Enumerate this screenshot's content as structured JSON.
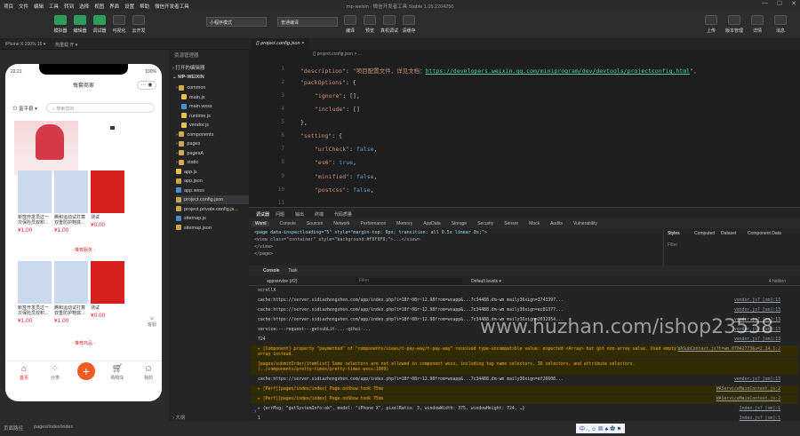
{
  "menubar": {
    "items": [
      "项目",
      "文件",
      "编辑",
      "工具",
      "转到",
      "选择",
      "视图",
      "界面",
      "设置",
      "帮助",
      "微信开发者工具"
    ],
    "title": "mp-weixin - 微信开发者工具 Stable 1.05.2204250"
  },
  "toolbar": {
    "left_buttons": [
      "模拟器",
      "编辑器",
      "调试器",
      "可视化",
      "云开发"
    ],
    "mode_select": "小程序模式",
    "compile_select": "普通编译",
    "right_buttons": [
      "编译",
      "预览",
      "真机调试",
      "清缓存"
    ],
    "far_right_buttons": [
      "上传",
      "版本管理",
      "详情",
      "消息"
    ]
  },
  "subbar": {
    "device": "iPhone X 100% 16 ▾",
    "hotreload": "热重载 开 ▾"
  },
  "editor_tab": {
    "label": "project.config.json"
  },
  "breadcrumb": "{} project.config.json > ...",
  "filetree": {
    "header": "资源管理器",
    "open_editors": "打开的编辑器",
    "root": "MP-WEIXIN",
    "items": [
      {
        "label": "common",
        "type": "folder",
        "indent": 1
      },
      {
        "label": "main.js",
        "type": "js",
        "indent": 2
      },
      {
        "label": "main.wxss",
        "type": "wxss",
        "indent": 2
      },
      {
        "label": "runtime.js",
        "type": "js",
        "indent": 2
      },
      {
        "label": "vendor.js",
        "type": "js",
        "indent": 2
      },
      {
        "label": "components",
        "type": "folder",
        "indent": 1
      },
      {
        "label": "pages",
        "type": "folder",
        "indent": 1
      },
      {
        "label": "pagesA",
        "type": "folder",
        "indent": 1
      },
      {
        "label": "static",
        "type": "folder",
        "indent": 1
      },
      {
        "label": "app.js",
        "type": "js",
        "indent": 1
      },
      {
        "label": "app.json",
        "type": "json",
        "indent": 1
      },
      {
        "label": "app.wxss",
        "type": "wxss",
        "indent": 1
      },
      {
        "label": "project.config.json",
        "type": "json",
        "indent": 1
      },
      {
        "label": "project.private.config.js...",
        "type": "json",
        "indent": 1
      },
      {
        "label": "sitemap.js",
        "type": "blue",
        "indent": 1
      },
      {
        "label": "sitemap.json",
        "type": "json",
        "indent": 1
      }
    ],
    "outline": "大纲"
  },
  "code": {
    "line_numbers": [
      "1",
      "2",
      "3",
      "4",
      "5",
      "6",
      "7",
      "8",
      "9",
      "10",
      "11"
    ],
    "description_key": "\"description\"",
    "description_value": "\"项目配置文件，详见文档：",
    "description_url": "https://developers.weixin.qq.com/miniprogram/dev/devtools/projectconfig.html",
    "packOptions_key": "\"packOptions\"",
    "ignore_key": "\"ignore\"",
    "include_key": "\"include\"",
    "setting_key": "\"setting\"",
    "urlCheck_key": "\"urlCheck\"",
    "es6_key": "\"es6\"",
    "minified_key": "\"minified\"",
    "postcss_key": "\"postcss\"",
    "false": "false",
    "true": "true"
  },
  "devtools": {
    "header_tabs": [
      "调试器",
      "问题",
      "输出",
      "终端",
      "代码质量"
    ],
    "panel_tabs": [
      "Wxml",
      "Console",
      "Sources",
      "Network",
      "Performance",
      "Memory",
      "AppData",
      "Storage",
      "Security",
      "Sensor",
      "Mock",
      "Audits",
      "Vulnerability"
    ],
    "elements_lines": [
      "<page data-inspectloading=\"5\" style=\"margin-top: 0px; transition: all 0.5s linear 0s;\">",
      "  <view class=\"container\" style=\"background:#F8F8F8;\">...</view>",
      "  </view>",
      "</page>"
    ],
    "styles_tabs": [
      "Styles",
      "Computed",
      "Dataset",
      "Component Data"
    ],
    "filter_placeholder": "Filter",
    "console_tabs": [
      "Console",
      "Task"
    ],
    "console_context": "appservice (#2)",
    "console_filter": "Filter",
    "console_levels": "Default levels ▾",
    "hidden": "4 hidden",
    "rows": [
      {
        "type": "log",
        "text": "scrollX",
        "src": ""
      },
      {
        "type": "log",
        "text": "cache:https://server.sidiazhongshen.com/app/index.php?i=18f~08r~12.98from=wxapp&...7c34488.dm-wm maily36xign=3743397...",
        "src": "vendor.js? [sm]:13"
      },
      {
        "type": "log",
        "text": "cache:https://server.sidiazhongshen.com/app/index.php?i=18f~08r~12.98from=wxapp&...7c34488.dm-wm maily36xign=ec81377...",
        "src": "vendor.js? [sm]:13"
      },
      {
        "type": "log",
        "text": "cache:https://server.sidiazhongshen.com/app/index.php?i=18f~08r~12.98from=wxapp&...7c34488.dm-wm maily36xign=2032954...",
        "src": "vendor.js? [sm]:13"
      },
      {
        "type": "log",
        "text": "service:---request---getsubLit-...-qihui-...",
        "src": "vendor.js? [sm]:13"
      },
      {
        "type": "log",
        "text": "724",
        "src": "vendor.js? [sm]:13"
      },
      {
        "type": "warn",
        "text": "▸ [Component] property \"paymethod\" of \"components/views/t-pay-way/t-pay-way\" received type-uncompatible value: expected <Array> but got non-array value. Used empty array instead.",
        "src": "WASubContext.js?t=wm.07042773&v=2.24.1:2"
      },
      {
        "type": "warn",
        "text": "[pages/submitOrder/itemlist] Some selectors are not allowed in component wxss, including tag name selectors, ID selectors, and attribute selectors.(../components/pretty-times/pretty-times.wxss:1909)",
        "src": ""
      },
      {
        "type": "log",
        "text": "cache:https://server.sidiazhongshen.com/app/index.php?i=18f~08r~12.98from=wxapp&...7c34488.dm-wm maily36xign=ef26608...",
        "src": "vendor.js? [sm]:13"
      },
      {
        "type": "warn",
        "text": "▸ [Perf][pages/index/index] Page.onShow took 75ms",
        "src": "WAServiceMainContext.js:2"
      },
      {
        "type": "warn",
        "text": "▸ [Perf][pages/index/index] Page.onShow took 75ms",
        "src": "WAServiceMainContext.js:2"
      },
      {
        "type": "log",
        "text": "▸ {errMsg: \"getSystemInfo:ok\", model: \"iPhone X\", pixelRatio: 3, windowWidth: 375, windowHeight: 724, …}",
        "src": "Index.js? [sm]:1"
      },
      {
        "type": "log",
        "text": "1",
        "src": "Index.js? [sm]:1"
      }
    ]
  },
  "phone": {
    "time": "22:21",
    "battery": "100%",
    "nav_title": "每套商家",
    "location": "富平县",
    "search_placeholder": "搜索您的",
    "products_row1": [
      {
        "name": "新签开发员过一次保险员双积...",
        "price": "¥1.00",
        "color": "#c9d9ee"
      },
      {
        "name": "腾和运动试打算 双重防护鞋底...",
        "price": "¥1.00",
        "color": "#c9d9ee"
      },
      {
        "name": "测试",
        "price": "¥0.00",
        "color": "#d62020"
      }
    ],
    "section_title": "- 推荐服务 -",
    "products_row2": [
      {
        "name": "新签开发员过一次保险员双积...",
        "price": "¥1.00",
        "color": "#c9d9ee"
      },
      {
        "name": "腾和运动试打算 双重防护鞋底...",
        "price": "¥1.00",
        "color": "#c9d9ee"
      },
      {
        "name": "测试",
        "price": "¥0.00",
        "color": "#d62020"
      }
    ],
    "section_title2": "- 推荐商品 -",
    "tabbar": [
      "首页",
      "分类",
      "",
      "购物车",
      "我的"
    ]
  },
  "statusbar": {
    "path_label": "页面路径",
    "path": "pages/index/index",
    "ime": "中 ·, ☺ ▦ ♣ ✿ ⚑"
  },
  "watermark": "www.huzhan.com/ishop23538",
  "colors": {
    "accent_green": "#2f9b5c",
    "phone_red": "#e02020",
    "warn_bg": "#332b00",
    "warn_text": "#f2ab26"
  }
}
